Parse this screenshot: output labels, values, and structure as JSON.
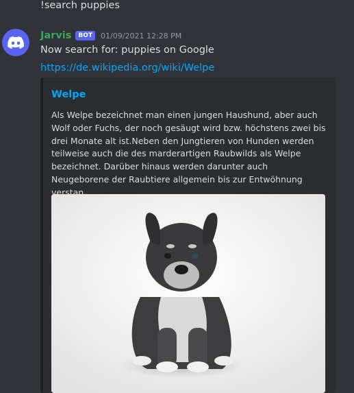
{
  "previous_message": {
    "text": "!search puppies"
  },
  "message": {
    "username": "Jarvis",
    "bot_tag": "BOT",
    "timestamp": "01/09/2021 12:28 PM",
    "text": "Now search for: puppies on Google",
    "link": "https://de.wikipedia.org/wiki/Welpe",
    "username_color": "#3ba55d",
    "avatar_color": "#5865f2"
  },
  "embed": {
    "title": "Welpe",
    "description": "Als Welpe bezeichnet man einen jungen Haushund, aber auch Wolf oder Fuchs, der noch gesäugt wird bzw. höchstens zwei bis drei Monate alt ist.Neben den Jungtieren von Hunden werden teilweise auch die des marderartigen Raubwilds als Welpe bezeichnet. Darüber hinaus werden darunter auch Neugeborene der Raubtiere allgemein bis zur Entwöhnung verstan...",
    "image_icon": "puppy-photo",
    "link_color": "#00a8fc"
  }
}
